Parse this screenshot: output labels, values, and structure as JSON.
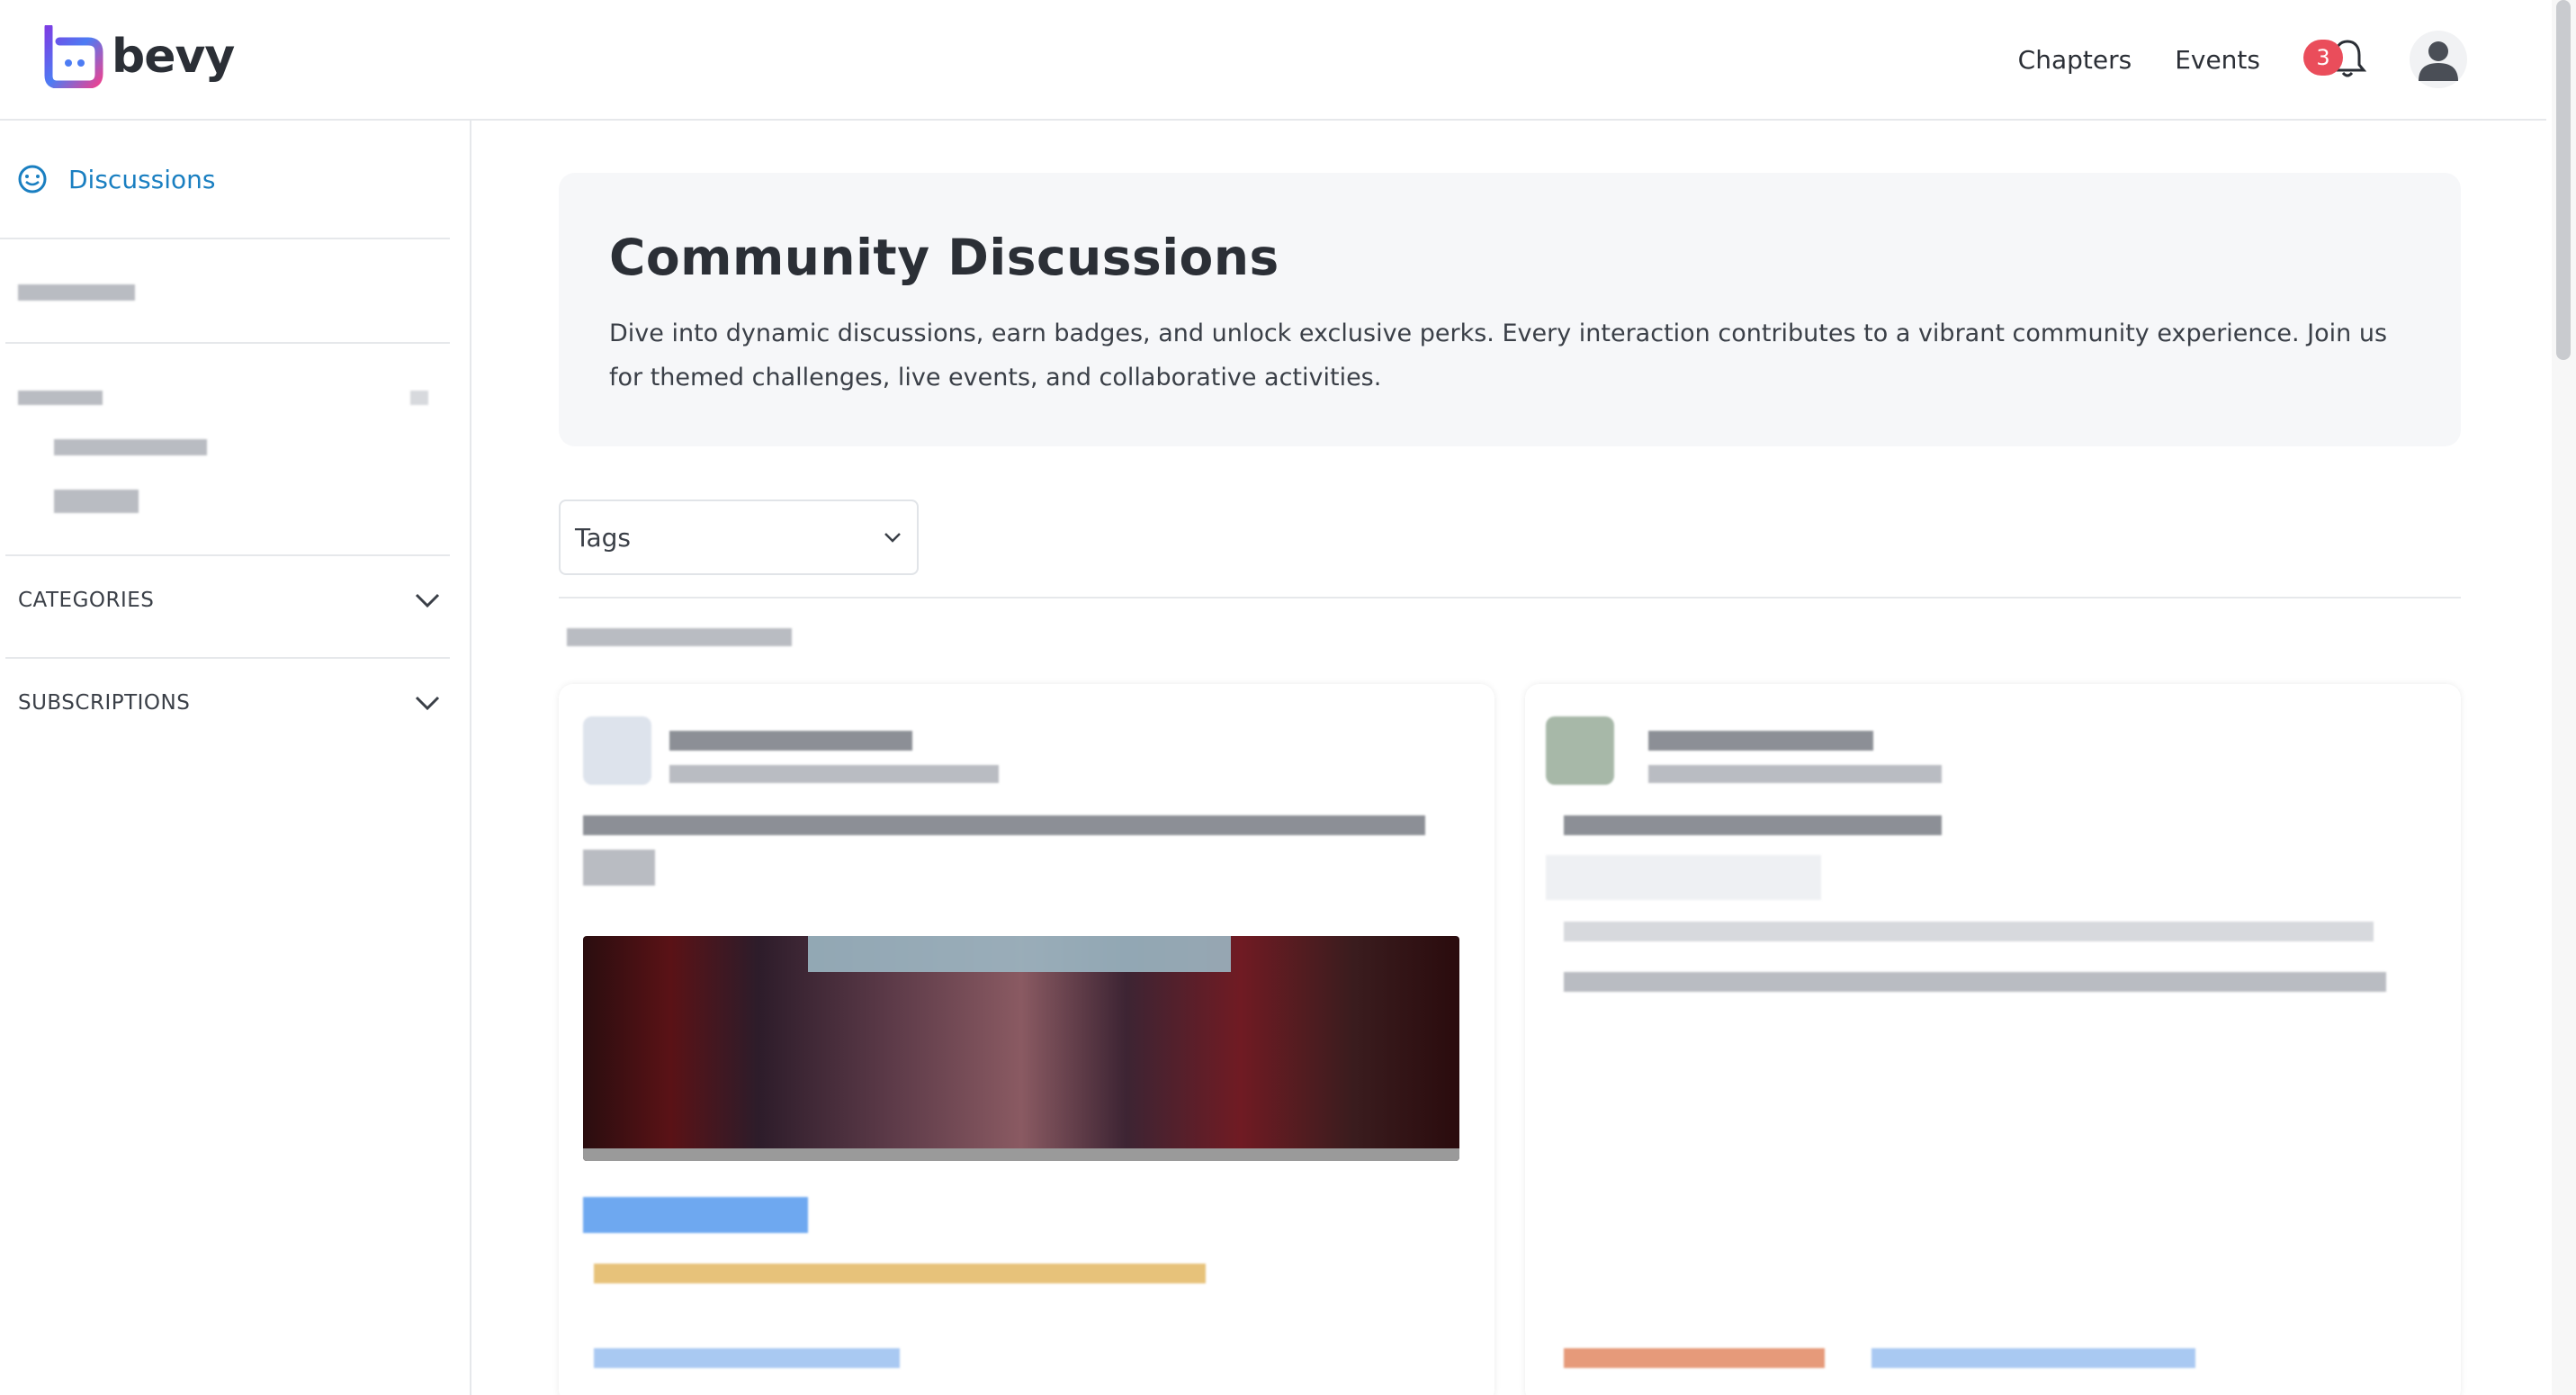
{
  "header": {
    "logo_text": "bevy",
    "nav": {
      "chapters": "Chapters",
      "events": "Events"
    },
    "notifications_count": "3"
  },
  "sidebar": {
    "active_item": "Discussions",
    "sections": [
      {
        "label": "CATEGORIES"
      },
      {
        "label": "SUBSCRIPTIONS"
      }
    ]
  },
  "hero": {
    "title": "Community Discussions",
    "description": "Dive into dynamic discussions, earn badges, and unlock exclusive perks. Every interaction contributes to a vibrant community experience. Join us for themed challenges, live events, and collaborative activities."
  },
  "filters": {
    "tags_label": "Tags"
  },
  "colors": {
    "accent": "#1a7fc1",
    "badge": "#ea4d5b",
    "hero_bg": "#f6f7f9"
  },
  "icons": [
    "discussion-icon",
    "bell-icon",
    "user-icon",
    "chevron-down-icon"
  ]
}
